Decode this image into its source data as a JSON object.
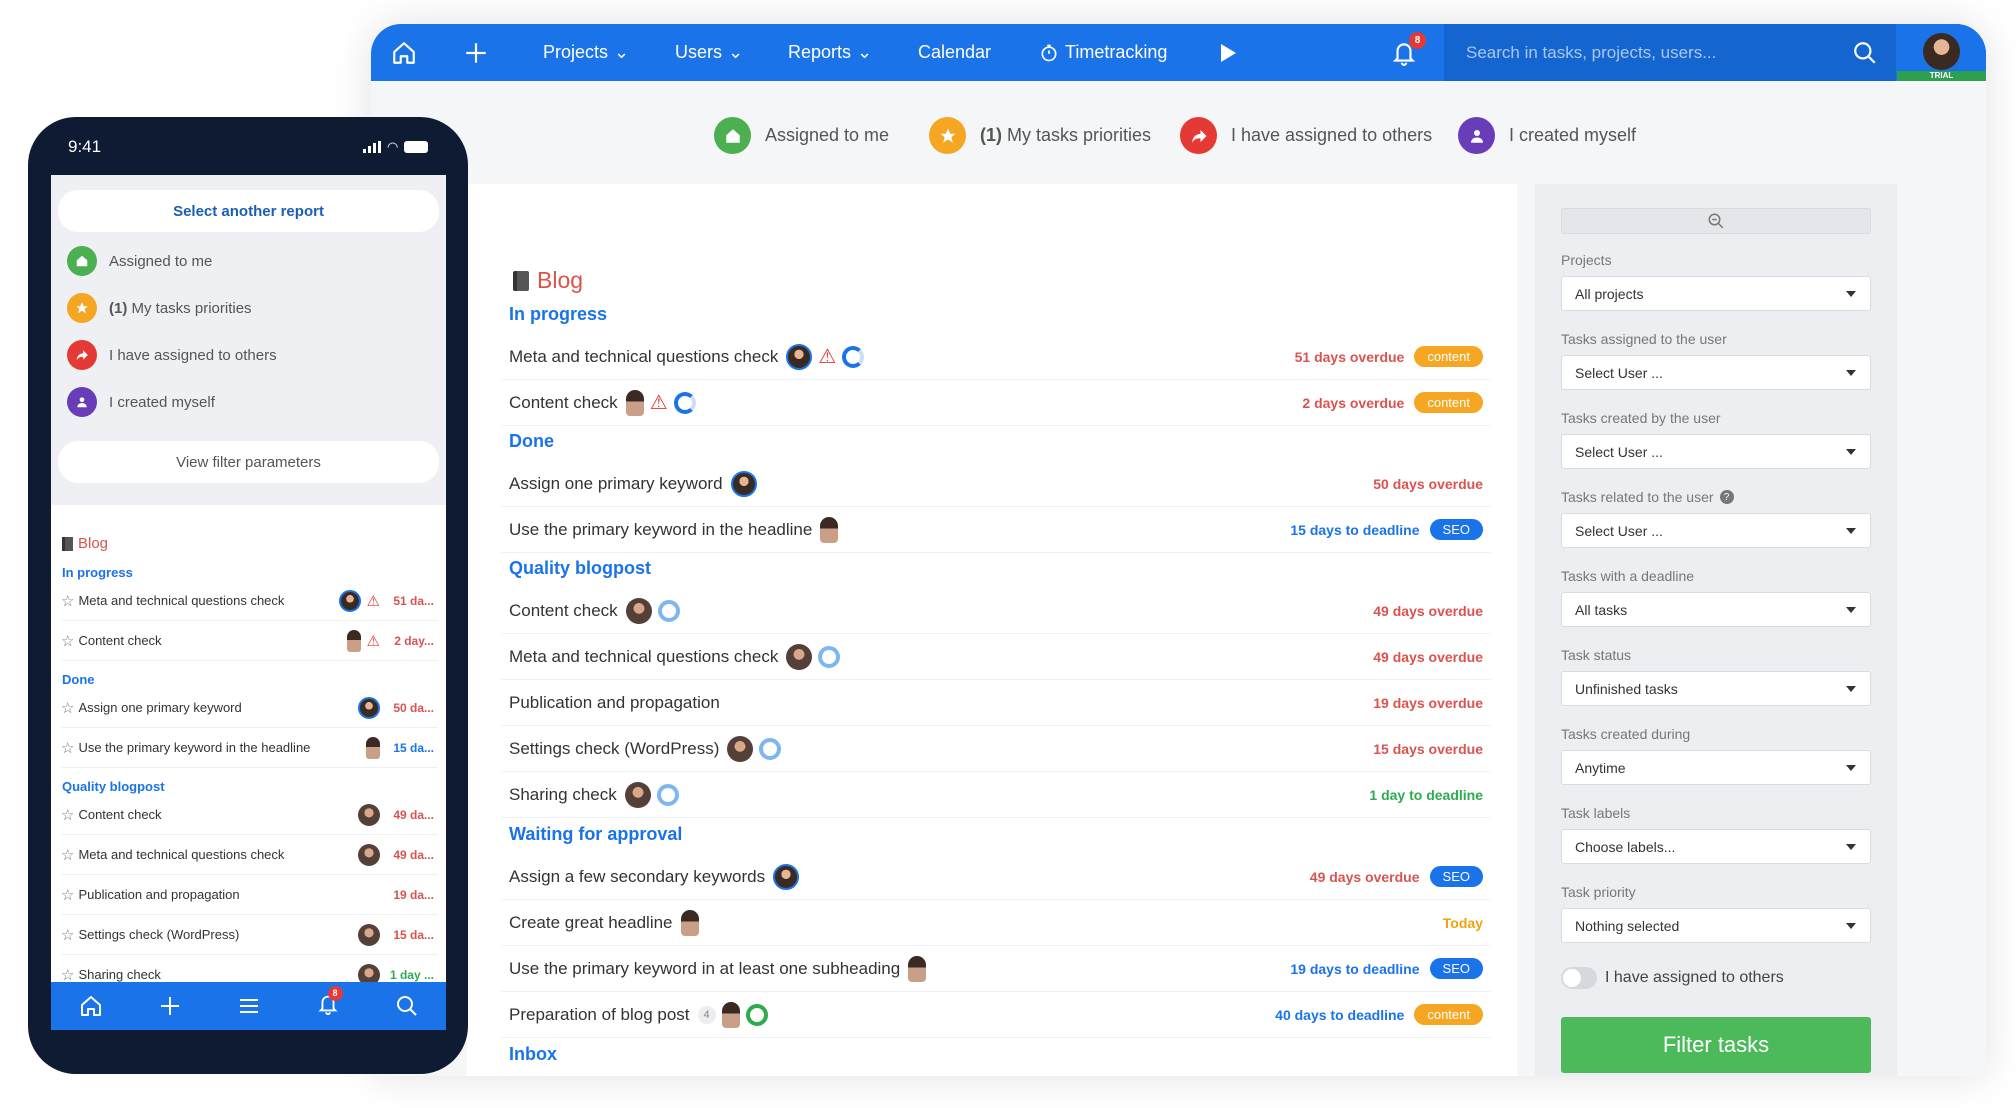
{
  "colors": {
    "primary": "#1a73e8",
    "overdue": "#d9534f",
    "deadline": "#1a73e8",
    "ok": "#2eab4f",
    "today": "#f0a30a",
    "content_tag": "#f5a623",
    "seo_tag": "#1a73e8",
    "filter_button": "#4cba5a"
  },
  "topbar": {
    "projects": "Projects",
    "users": "Users",
    "reports": "Reports",
    "calendar": "Calendar",
    "timetracking": "Timetracking",
    "notif_count": "8",
    "search_placeholder": "Search in tasks, projects, users...",
    "trial": "TRIAL"
  },
  "quicklinks": [
    {
      "label": "Assigned to me",
      "color": "#4caf50",
      "icon": "home-icon"
    },
    {
      "prefix": "(1)",
      "label": " My tasks priorities",
      "color": "#f5a623",
      "icon": "star-icon"
    },
    {
      "label": "I have assigned to others",
      "color": "#e53935",
      "icon": "share-arrow-icon"
    },
    {
      "label": "I created myself",
      "color": "#6a3db8",
      "icon": "user-icon"
    }
  ],
  "report": {
    "title": "Blog",
    "sections": [
      {
        "name": "In progress"
      },
      {
        "name": "Done"
      },
      {
        "name": "Quality blogpost"
      },
      {
        "name": "Waiting for approval"
      },
      {
        "name": "Inbox"
      }
    ],
    "tasks": [
      {
        "name": "Meta and technical questions check",
        "due": "51 days overdue",
        "tag": "content",
        "status": "overdue"
      },
      {
        "name": "Content check",
        "due": "2 days overdue",
        "tag": "content",
        "status": "overdue"
      },
      {
        "name": "Assign one primary keyword",
        "due": "50 days overdue",
        "tag": "",
        "status": "overdue"
      },
      {
        "name": "Use the primary keyword in the headline",
        "due": "15 days to deadline",
        "tag": "SEO",
        "status": "deadline"
      },
      {
        "name": "Content check",
        "due": "49 days overdue",
        "tag": "",
        "status": "overdue"
      },
      {
        "name": "Meta and technical questions check",
        "due": "49 days overdue",
        "tag": "",
        "status": "overdue"
      },
      {
        "name": "Publication and propagation",
        "due": "19 days overdue",
        "tag": "",
        "status": "overdue"
      },
      {
        "name": "Settings check (WordPress)",
        "due": "15 days overdue",
        "tag": "",
        "status": "overdue"
      },
      {
        "name": "Sharing check",
        "due": "1 day to deadline",
        "tag": "",
        "status": "ok"
      },
      {
        "name": "Assign a few secondary keywords",
        "due": "49 days overdue",
        "tag": "SEO",
        "status": "overdue"
      },
      {
        "name": "Create great headline",
        "due": "Today",
        "tag": "",
        "status": "today"
      },
      {
        "name": "Use the primary keyword in at least one subheading",
        "due": "19 days to deadline",
        "tag": "SEO",
        "status": "deadline"
      },
      {
        "name": "Preparation of blog post",
        "count": "4",
        "due": "40 days to deadline",
        "tag": "content",
        "status": "deadline"
      }
    ]
  },
  "filters": {
    "items": [
      {
        "label": "Projects",
        "value": "All projects"
      },
      {
        "label": "Tasks assigned to the user",
        "value": "Select User ..."
      },
      {
        "label": "Tasks created by the user",
        "value": "Select User ..."
      },
      {
        "label": "Tasks related to the user",
        "value": "Select User ..."
      },
      {
        "label": "Tasks with a deadline",
        "value": "All tasks"
      },
      {
        "label": "Task status",
        "value": "Unfinished tasks"
      },
      {
        "label": "Tasks created during",
        "value": "Anytime"
      },
      {
        "label": "Task labels",
        "value": "Choose labels..."
      },
      {
        "label": "Task priority",
        "value": "Nothing selected"
      }
    ],
    "toggle_label": "I have assigned to others",
    "submit": "Filter tasks"
  },
  "phone": {
    "time": "9:41",
    "select_report": "Select another report",
    "view_filter": "View filter parameters",
    "notif_count": "8",
    "tasks": [
      {
        "name": "Meta and technical questions check",
        "due": "51 da...",
        "status": "overdue"
      },
      {
        "name": "Content check",
        "due": "2 day...",
        "status": "overdue"
      },
      {
        "name": "Assign one primary keyword",
        "due": "50 da...",
        "status": "overdue"
      },
      {
        "name": "Use the primary keyword in the headline",
        "due": "15 da...",
        "status": "deadline"
      },
      {
        "name": "Content check",
        "due": "49 da...",
        "status": "overdue"
      },
      {
        "name": "Meta and technical questions check",
        "due": "49 da...",
        "status": "overdue"
      },
      {
        "name": "Publication and propagation",
        "due": "19 da...",
        "status": "overdue"
      },
      {
        "name": "Settings check (WordPress)",
        "due": "15 da...",
        "status": "overdue"
      },
      {
        "name": "Sharing check",
        "due": "1 day ...",
        "status": "ok"
      }
    ]
  }
}
